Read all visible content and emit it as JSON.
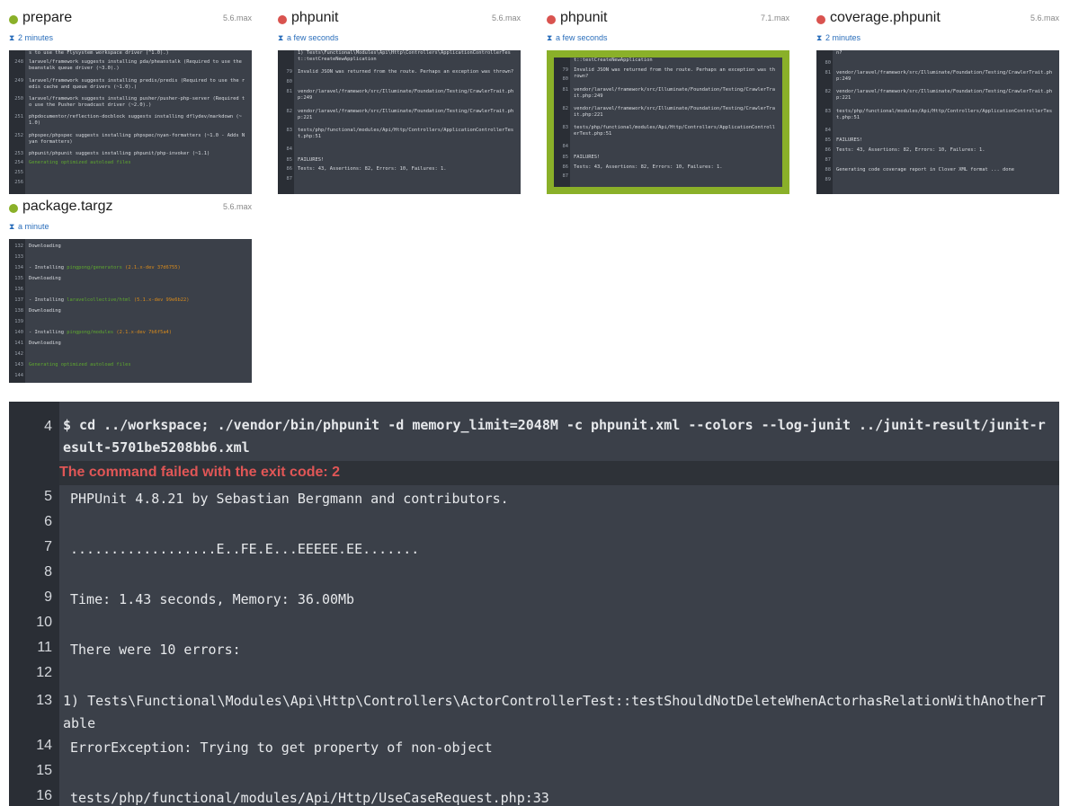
{
  "cards": [
    {
      "title": "prepare",
      "version": "5.6.max",
      "time": "2 minutes",
      "status": "success",
      "lines": [
        {
          "n": "",
          "t": "s to use the Flysystem workspace driver (^1.0).)"
        },
        {
          "n": "248",
          "t": "laravel/framework suggests installing pda/pheanstalk (Required to use the beanstalk queue driver (~3.0).)"
        },
        {
          "n": "249",
          "t": "laravel/framework suggests installing predis/predis (Required to use the redis cache and queue drivers (~1.0).)"
        },
        {
          "n": "250",
          "t": "laravel/framework suggests installing pusher/pusher-php-server (Required to use the Pusher broadcast driver (~2.0).)"
        },
        {
          "n": "251",
          "t": "phpdocumentor/reflection-docblock suggests installing dflydev/markdown (~1.0)"
        },
        {
          "n": "252",
          "t": "phpspec/phpspec suggests installing phpspec/nyan-formatters (~1.0 - Adds Nyan formatters)"
        },
        {
          "n": "253",
          "t": "phpunit/phpunit suggests installing phpunit/php-invoker (~1.1)"
        },
        {
          "n": "254",
          "t": "Generating optimized autoload files",
          "green": true
        },
        {
          "n": "255",
          "t": ""
        },
        {
          "n": "256",
          "t": ""
        }
      ]
    },
    {
      "title": "phpunit",
      "version": "5.6.max",
      "time": "a few seconds",
      "status": "failed",
      "lines": [
        {
          "n": "",
          "t": "1) Tests\\Functional\\Modules\\Api\\Http\\Controllers\\ApplicationControllerTest::testCreateNewApplication"
        },
        {
          "n": "79",
          "t": "Invalid JSON was returned from the route. Perhaps an exception was thrown?"
        },
        {
          "n": "80",
          "t": ""
        },
        {
          "n": "81",
          "t": "vendor/laravel/framework/src/Illuminate/Foundation/Testing/CrawlerTrait.php:249"
        },
        {
          "n": "82",
          "t": "vendor/laravel/framework/src/Illuminate/Foundation/Testing/CrawlerTrait.php:221"
        },
        {
          "n": "83",
          "t": "tests/php/functional/modules/Api/Http/Controllers/ApplicationControllerTest.php:51"
        },
        {
          "n": "84",
          "t": ""
        },
        {
          "n": "85",
          "t": "FAILURES!"
        },
        {
          "n": "86",
          "t": "Tests: 43, Assertions: 82, Errors: 10, Failures: 1."
        },
        {
          "n": "87",
          "t": ""
        }
      ]
    },
    {
      "title": "phpunit",
      "version": "7.1.max",
      "time": "a few seconds",
      "status": "failed",
      "lines": [
        {
          "n": "",
          "t": "t::testCreateNewApplication"
        },
        {
          "n": "79",
          "t": "Invalid JSON was returned from the route. Perhaps an exception was thrown?"
        },
        {
          "n": "80",
          "t": ""
        },
        {
          "n": "81",
          "t": "vendor/laravel/framework/src/Illuminate/Foundation/Testing/CrawlerTrait.php:249"
        },
        {
          "n": "82",
          "t": "vendor/laravel/framework/src/Illuminate/Foundation/Testing/CrawlerTrait.php:221"
        },
        {
          "n": "83",
          "t": "tests/php/functional/modules/Api/Http/Controllers/ApplicationControllerTest.php:51"
        },
        {
          "n": "84",
          "t": ""
        },
        {
          "n": "85",
          "t": "FAILURES!"
        },
        {
          "n": "86",
          "t": "Tests: 43, Assertions: 82, Errors: 10, Failures: 1."
        },
        {
          "n": "87",
          "t": ""
        }
      ]
    },
    {
      "title": "coverage.phpunit",
      "version": "5.6.max",
      "time": "2 minutes",
      "status": "failed",
      "lines": [
        {
          "n": "",
          "t": "n?"
        },
        {
          "n": "80",
          "t": ""
        },
        {
          "n": "81",
          "t": "vendor/laravel/framework/src/Illuminate/Foundation/Testing/CrawlerTrait.php:249"
        },
        {
          "n": "82",
          "t": "vendor/laravel/framework/src/Illuminate/Foundation/Testing/CrawlerTrait.php:221"
        },
        {
          "n": "83",
          "t": "tests/php/functional/modules/Api/Http/Controllers/ApplicationControllerTest.php:51"
        },
        {
          "n": "84",
          "t": ""
        },
        {
          "n": "85",
          "t": "FAILURES!"
        },
        {
          "n": "86",
          "t": "Tests: 43, Assertions: 82, Errors: 10, Failures: 1."
        },
        {
          "n": "87",
          "t": ""
        },
        {
          "n": "88",
          "t": "Generating code coverage report in Clover XML format ... done"
        },
        {
          "n": "89",
          "t": ""
        }
      ]
    },
    {
      "title": "package.targz",
      "version": "5.6.max",
      "time": "a minute",
      "status": "success",
      "lines": [
        {
          "n": "132",
          "t": "Downloading"
        },
        {
          "n": "133",
          "t": ""
        },
        {
          "n": "134",
          "t": "- Installing ",
          "pkg": "pingpong/generators",
          "ver": "(2.1.x-dev 37d6755)"
        },
        {
          "n": "135",
          "t": "Downloading"
        },
        {
          "n": "136",
          "t": ""
        },
        {
          "n": "137",
          "t": "- Installing ",
          "pkg": "laravelcollective/html",
          "ver": "(5.1.x-dev 99e6b22)"
        },
        {
          "n": "138",
          "t": "Downloading"
        },
        {
          "n": "139",
          "t": ""
        },
        {
          "n": "140",
          "t": "- Installing ",
          "pkg": "pingpong/modules",
          "ver": "(2.1.x-dev 7b6f5a4)"
        },
        {
          "n": "141",
          "t": "Downloading"
        },
        {
          "n": "142",
          "t": ""
        },
        {
          "n": "143",
          "t": "Generating optimized autoload files",
          "green": true
        },
        {
          "n": "144",
          "t": ""
        }
      ]
    }
  ],
  "log": {
    "command_line_number": "4",
    "command": "$ cd ../workspace; ./vendor/bin/phpunit -d memory_limit=2048M -c phpunit.xml --colors --log-junit ../junit-result/junit-result-5701be5208bb6.xml",
    "failure_message": "The command failed with the exit code: 2",
    "lines": [
      {
        "n": "5",
        "t": "PHPUnit 4.8.21 by Sebastian Bergmann and contributors."
      },
      {
        "n": "6",
        "t": ""
      },
      {
        "n": "7",
        "t": "..................E..FE.E...EEEEE.EE......."
      },
      {
        "n": "8",
        "t": ""
      },
      {
        "n": "9",
        "t": "Time: 1.43 seconds, Memory: 36.00Mb"
      },
      {
        "n": "10",
        "t": ""
      },
      {
        "n": "11",
        "t": "There were 10 errors:"
      },
      {
        "n": "12",
        "t": ""
      },
      {
        "n": "13",
        "t": "1) Tests\\Functional\\Modules\\Api\\Http\\Controllers\\ActorControllerTest::testShouldNotDeleteWhenActorhasRelationWithAnotherTable"
      },
      {
        "n": "14",
        "t": "ErrorException: Trying to get property of non-object"
      },
      {
        "n": "15",
        "t": ""
      },
      {
        "n": "16",
        "t": "tests/php/functional/modules/Api/Http/UseCaseRequest.php:33"
      }
    ]
  },
  "colors": {
    "success": "#8ab029",
    "failed": "#d9534f",
    "terminal_bg": "#3b4049",
    "gutter_bg": "#2a2e35",
    "error_text": "#e05656",
    "link": "#2a6ebb"
  }
}
